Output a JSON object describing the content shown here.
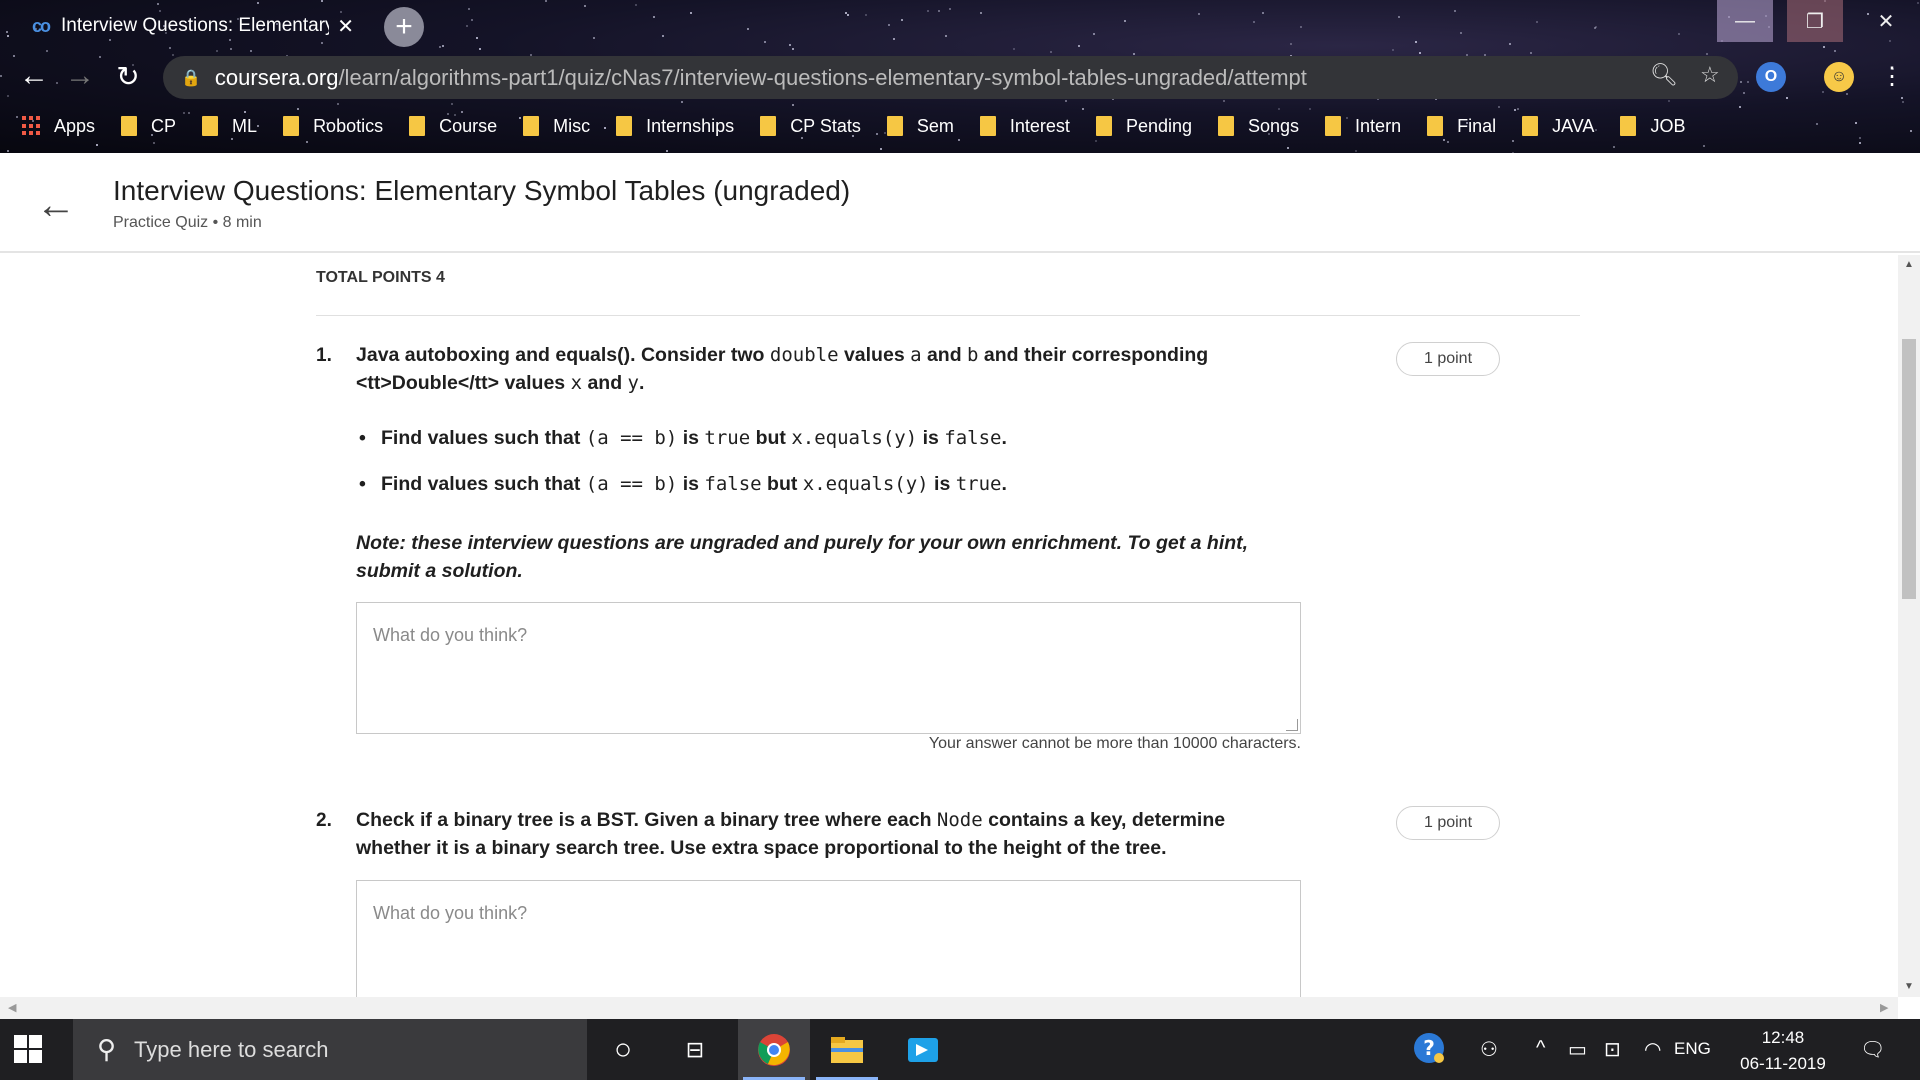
{
  "browser": {
    "tab_title": "Interview Questions: Elementary",
    "tab_close": "✕",
    "new_tab": "+",
    "url_host": "coursera.org",
    "url_path": "/learn/algorithms-part1/quiz/cNas7/interview-questions-elementary-symbol-tables-ungraded/attempt",
    "bookmarks": [
      "Apps",
      "CP",
      "ML",
      "Robotics",
      "Course",
      "Misc",
      "Internships",
      "CP Stats",
      "Sem",
      "Interest",
      "Pending",
      "Songs",
      "Intern",
      "Final",
      "JAVA",
      "JOB"
    ]
  },
  "header": {
    "title": "Interview Questions: Elementary Symbol Tables (ungraded)",
    "subtitle": "Practice Quiz • 8 min"
  },
  "quiz": {
    "total_points": "TOTAL POINTS 4",
    "answer_placeholder": "What do you think?",
    "answer_limit": "Your answer cannot be more than 10000 characters.",
    "q1": {
      "number": "1.",
      "points": "1 point",
      "line1_a": "Java autoboxing and equals(). Consider two ",
      "line1_code1": "double",
      "line1_b": " values ",
      "line1_code2": "a",
      "line1_c": " and ",
      "line1_code3": "b",
      "line1_d": " and their corresponding",
      "line2_a": "<tt>Double</tt> values ",
      "line2_code1": "x",
      "line2_b": " and ",
      "line2_code2": "y",
      "line2_c": ".",
      "bullet1_a": "Find values such that ",
      "bullet1_code1": "(a == b)",
      "bullet1_b": " is ",
      "bullet1_code2": "true",
      "bullet1_c": " but ",
      "bullet1_code3": "x.equals(y)",
      "bullet1_d": " is ",
      "bullet1_code4": "false",
      "bullet1_e": ".",
      "bullet2_a": "Find values such that ",
      "bullet2_code1": "(a == b)",
      "bullet2_b": " is ",
      "bullet2_code2": "false",
      "bullet2_c": " but ",
      "bullet2_code3": "x.equals(y)",
      "bullet2_d": " is ",
      "bullet2_code4": "true",
      "bullet2_e": ".",
      "note_line1": "Note: these interview questions are ungraded and purely for your own enrichment. To get a hint,",
      "note_line2": "submit a solution."
    },
    "q2": {
      "number": "2.",
      "points": "1 point",
      "line1_a": "Check if a binary tree is a BST. Given a binary tree where each ",
      "line1_code": "Node",
      "line1_b": " contains a key, determine",
      "line2": "whether it is a binary search tree. Use extra space proportional to the height of the tree."
    }
  },
  "taskbar": {
    "search_placeholder": "Type here to search",
    "language": "ENG",
    "time": "12:48",
    "date": "06-11-2019"
  }
}
